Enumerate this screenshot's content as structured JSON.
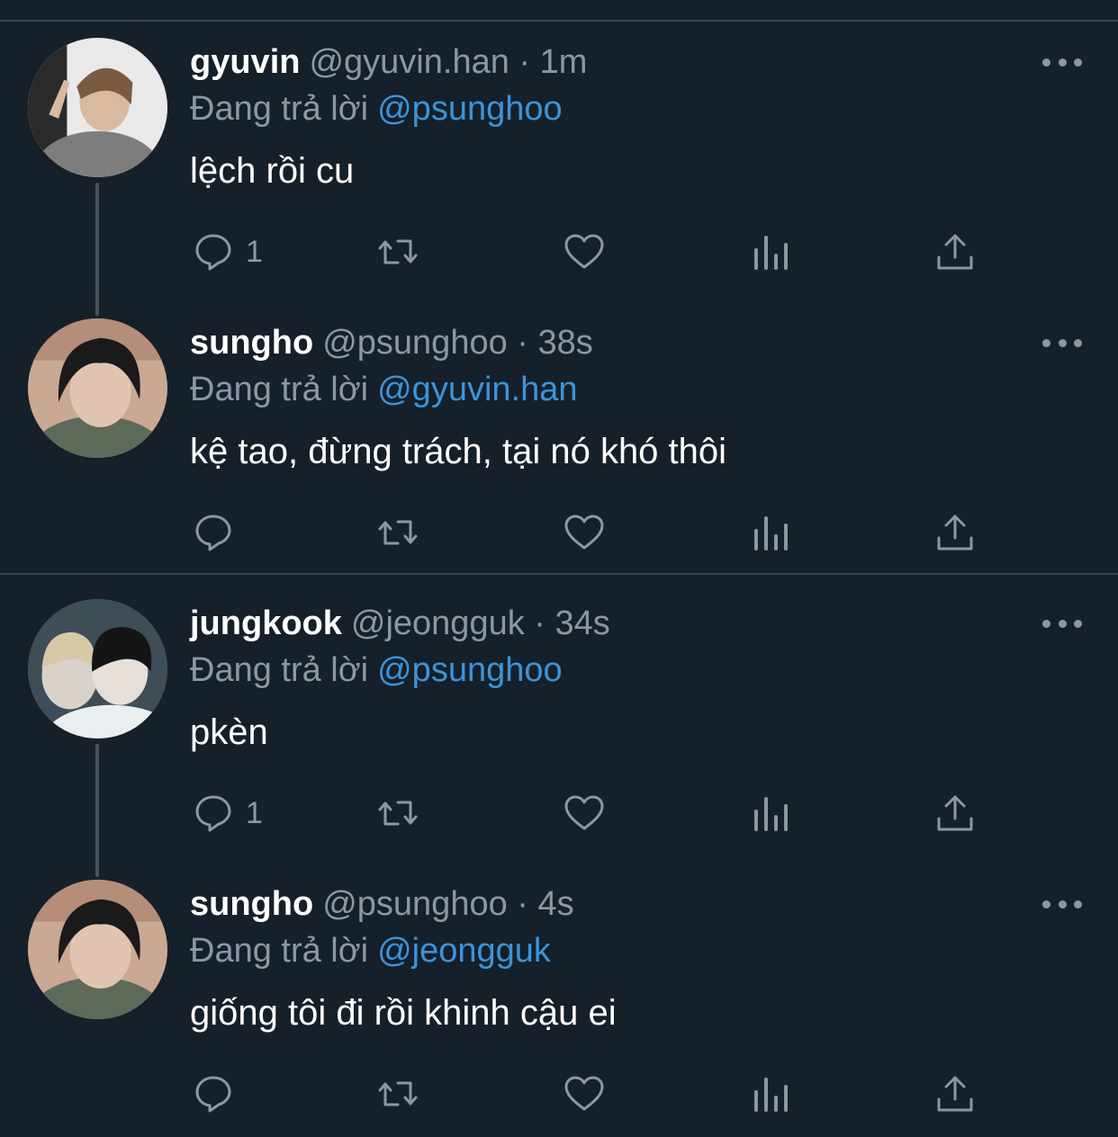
{
  "colors": {
    "background": "#15202b",
    "divider": "#38444d",
    "muted": "#8899a6",
    "mention": "#3b94d9"
  },
  "tweets": [
    {
      "name": "gyuvin",
      "handle": "@gyuvin.han",
      "time": "· 1m",
      "reply_prefix": "Đang trả lời",
      "reply_to": "@psunghoo",
      "text": "lệch rồi cu",
      "reply_count": "1"
    },
    {
      "name": "sungho",
      "handle": "@psunghoo",
      "time": "· 38s",
      "reply_prefix": "Đang trả lời",
      "reply_to": "@gyuvin.han",
      "text": "kệ tao, đừng trách, tại nó khó thôi",
      "reply_count": ""
    },
    {
      "name": "jungkook",
      "handle": "@jeongguk",
      "time": "· 34s",
      "reply_prefix": "Đang trả lời",
      "reply_to": "@psunghoo",
      "text": "pkèn",
      "reply_count": "1"
    },
    {
      "name": "sungho",
      "handle": "@psunghoo",
      "time": "· 4s",
      "reply_prefix": "Đang trả lời",
      "reply_to": "@jeongguk",
      "text": "giống tôi đi rồi khinh cậu ei",
      "reply_count": ""
    }
  ],
  "icons": [
    "reply-icon",
    "retweet-icon",
    "like-icon",
    "analytics-icon",
    "share-icon",
    "more-icon"
  ]
}
